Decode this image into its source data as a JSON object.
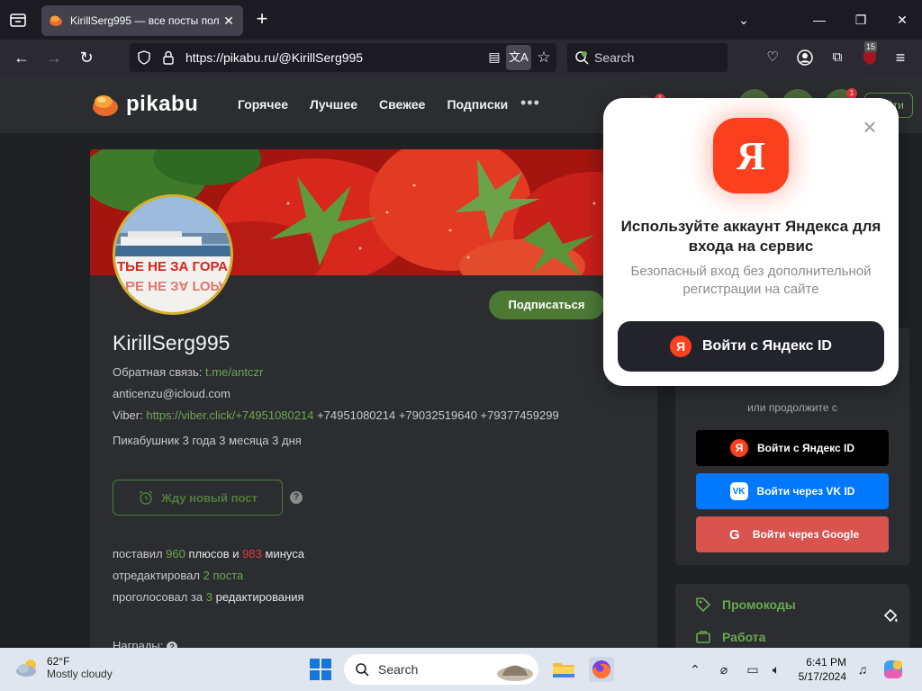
{
  "browser": {
    "tab_title": "KirillSerg995 — все посты пол",
    "url": "https://pikabu.ru/@KirillSerg995",
    "search_placeholder": "Search",
    "extension_badge": "15"
  },
  "site": {
    "logo": "pikabu",
    "nav": [
      "Горячее",
      "Лучшее",
      "Свежее",
      "Подписки"
    ],
    "more": "•••",
    "login_label": "Войти",
    "badge_1": "1",
    "badge_2": "1"
  },
  "profile": {
    "subscribe_label": "Подписаться",
    "username": "KirillSerg995",
    "feedback_label": "Обратная связь:",
    "feedback_link": "t.me/antczr",
    "email": "anticenzu@icloud.com",
    "viber_label": "Viber:",
    "viber_link": "https://viber.click/+74951080214",
    "phones": "+74951080214 +79032519640 +79377459299",
    "member_since": "Пикабушник 3 года 3 месяца 3 дня",
    "wait_label": "Жду новый пост",
    "help": "?",
    "stats": {
      "p1": "поставил",
      "plus_count": "960",
      "p2": "плюсов и",
      "minus_count": "983",
      "p3": "минуса",
      "edited_prefix": "отредактировал",
      "edited_count": "2 поста",
      "voted_prefix": "проголосовал за",
      "voted_count": "3",
      "voted_suffix": "редактирования"
    },
    "awards_label": "Награды:"
  },
  "login_panel": {
    "or_text": "или продолжите с",
    "yandex": "Войти с Яндекс ID",
    "vk": "Войти через VK ID",
    "google": "Войти через Google"
  },
  "side_links": [
    "Промокоды",
    "Работа"
  ],
  "yandex_popup": {
    "title": "Используйте аккаунт Яндекса для входа на сервис",
    "subtitle": "Безопасный вход без дополнительной регистрации на сайте",
    "button": "Войти с Яндекс ID",
    "logo_letter": "Я"
  },
  "taskbar": {
    "temperature": "62°F",
    "condition": "Mostly cloudy",
    "search": "Search",
    "time": "6:41 PM",
    "date": "5/17/2024"
  },
  "colors": {
    "pikabu_green": "#6aa84f",
    "yandex_red": "#fc3f1d",
    "vk_blue": "#0077ff",
    "google_red": "#d9534f"
  }
}
